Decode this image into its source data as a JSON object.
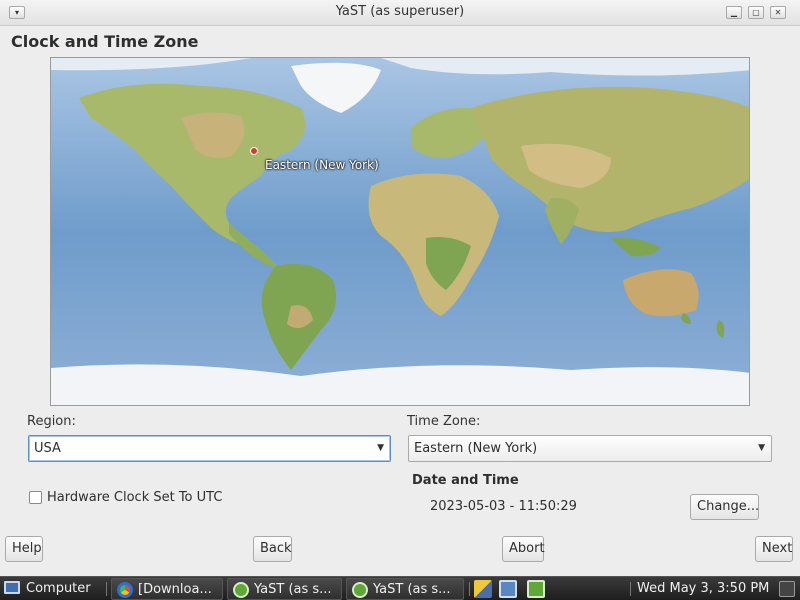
{
  "window": {
    "title": "YaST (as superuser)",
    "menu_glyph": "▾",
    "minimize_glyph": "▁",
    "maximize_glyph": "▢",
    "close_glyph": "✕"
  },
  "page": {
    "heading": "Clock and Time Zone"
  },
  "map": {
    "marker_label": "Eastern (New York)",
    "marker_color": "#d83a2a"
  },
  "region": {
    "label": "Region:",
    "value": "USA"
  },
  "timezone": {
    "label": "Time Zone:",
    "value": "Eastern (New York)"
  },
  "combo_arrow": "▼",
  "hardware_clock": {
    "label": "Hardware Clock Set To UTC",
    "checked": false
  },
  "date_time": {
    "heading": "Date and Time",
    "value": "2023-05-03 - 11:50:29",
    "change_label": "Change..."
  },
  "buttons": {
    "help": "Help",
    "back": "Back",
    "abort": "Abort",
    "next": "Next"
  },
  "taskbar": {
    "computer": "Computer",
    "tasks": [
      "[Downloa...",
      "YaST (as s...",
      "YaST (as s..."
    ],
    "clock": "Wed May  3,  3:50 PM",
    "accent": "#2e2e2e"
  }
}
